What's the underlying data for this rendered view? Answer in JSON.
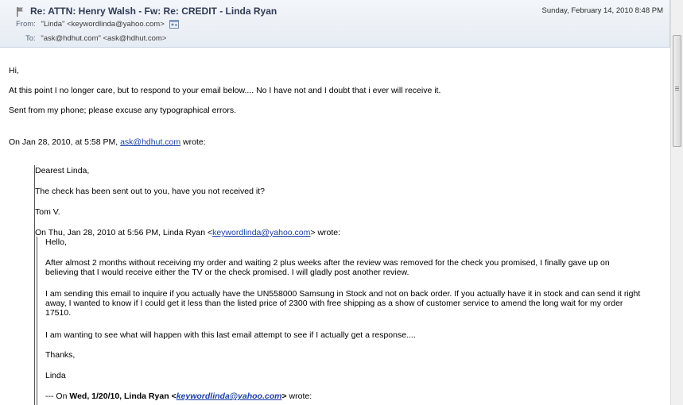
{
  "header": {
    "subject": "Re: ATTN: Henry Walsh - Fw: Re: CREDIT - Linda Ryan",
    "date": "Sunday, February 14, 2010 8:48 PM",
    "from_label": "From:",
    "from_value": "\"Linda\" <keywordlinda@yahoo.com>",
    "to_label": "To:",
    "to_value": "\"ask@hdhut.com\" <ask@hdhut.com>"
  },
  "message": {
    "greeting": "Hi,",
    "para1": "At this point I no longer care, but to respond to your email below.... No I have not and I doubt that i  ever will receive it.",
    "signature": "Sent from my phone; please excuse any typographical errors.",
    "attribution_prefix": "On Jan 28, 2010, at 5:58 PM,",
    "attribution_email": "ask@hdhut.com",
    "attribution_suffix": "wrote:"
  },
  "quote1": {
    "greeting": "Dearest Linda,",
    "line1": "The check has been sent out to you, have you not received it?",
    "sign": "Tom V.",
    "attribution_prefix": "On Thu, Jan 28, 2010 at 5:56 PM, Linda Ryan <",
    "attribution_email": "keywordlinda@yahoo.com",
    "attribution_suffix": "> wrote:"
  },
  "quote2": {
    "greeting": "Hello,",
    "para1": "After almost 2 months without receiving my order and waiting 2 plus weeks after the review was removed for the check you promised, I finally gave up on believing that I would receive either the TV or the check promised.  I will gladly post another review.",
    "para2": "I am sending this email to inquire if you actually have the UN558000 Samsung in Stock and not on back order.  If you actually have it in stock and can send it right away, I wanted to know if I could get it less than the listed price of 2300 with free shipping as a show of customer service to amend the long wait for my order 17510.",
    "para3": "I am wanting to see what will happen with this last email attempt to see if I actually get a response....",
    "thanks": "Thanks,",
    "name": "Linda",
    "attribution_prefix": "--- On",
    "attribution_date": "Wed, 1/20/10, Linda Ryan",
    "attribution_open": "<",
    "attribution_email": "keywordlinda@yahoo.com",
    "attribution_close": ">",
    "attribution_suffix": "wrote:"
  },
  "icons": {
    "flag": "flag-icon",
    "contact": "contact-card-icon"
  },
  "colors": {
    "header_bg": "#e9eef4",
    "subject": "#2f3a55",
    "link": "#1a3ea8"
  }
}
